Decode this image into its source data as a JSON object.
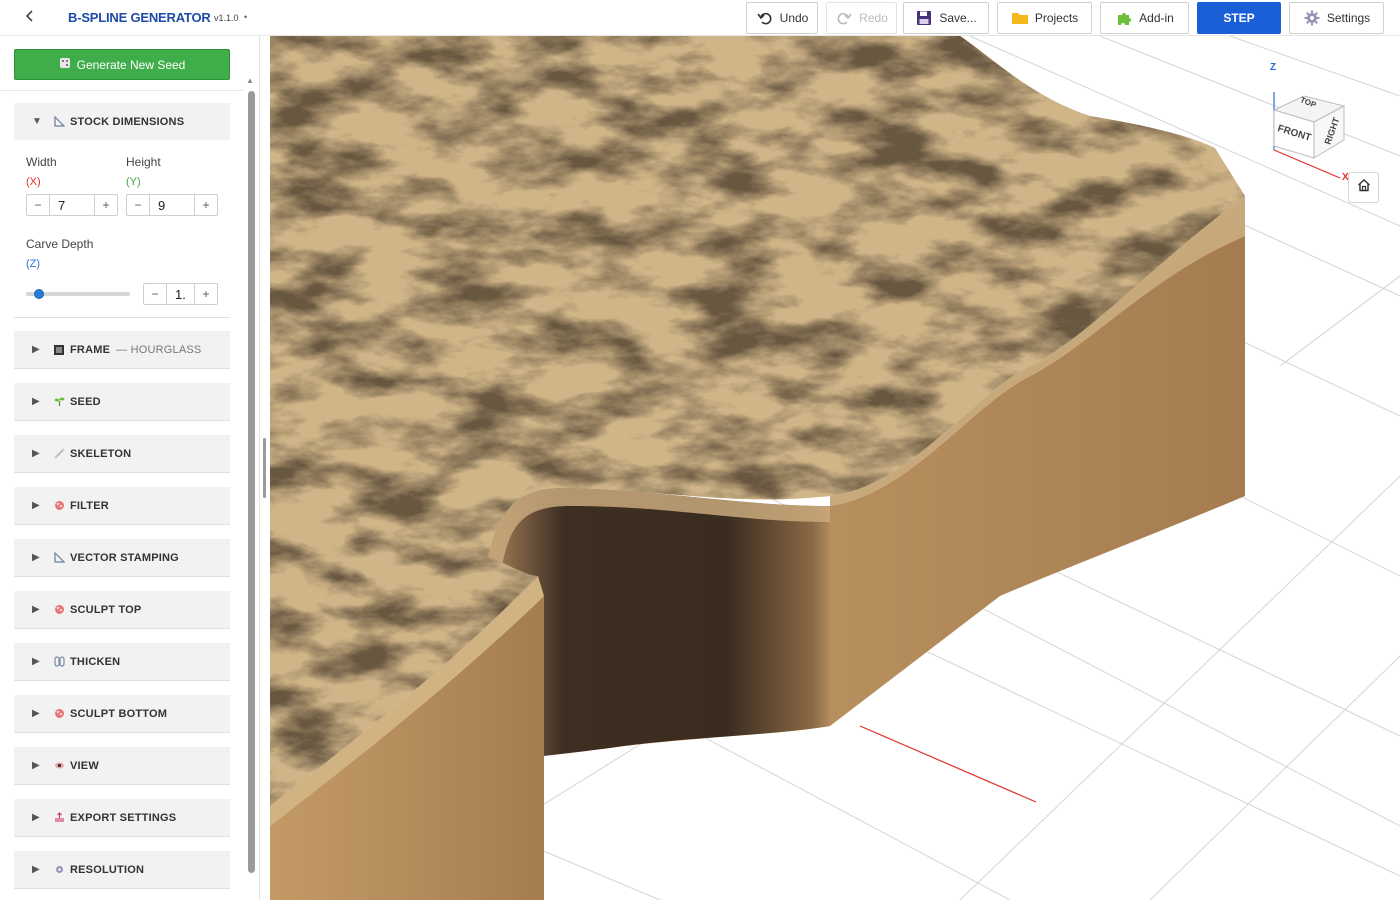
{
  "app": {
    "title": "B-SPLINE GENERATOR",
    "version": "v1.1.0",
    "dot": "•"
  },
  "toolbar": {
    "undo": "Undo",
    "redo": "Redo",
    "save": "Save...",
    "projects": "Projects",
    "addin": "Add-in",
    "step": "STEP",
    "settings": "Settings"
  },
  "sidebar": {
    "generate_label": "Generate New Seed",
    "stock": {
      "title": "STOCK DIMENSIONS",
      "width_label": "Width",
      "width_axis": "(X)",
      "width_value": "7",
      "height_label": "Height",
      "height_axis": "(Y)",
      "height_value": "9",
      "depth_label": "Carve Depth",
      "depth_axis": "(Z)",
      "depth_value": "1.",
      "depth_slider_fraction": 0.1
    },
    "sections": [
      {
        "title": "FRAME",
        "sub": "— HOURGLASS"
      },
      {
        "title": "SEED",
        "sub": ""
      },
      {
        "title": "SKELETON",
        "sub": ""
      },
      {
        "title": "FILTER",
        "sub": ""
      },
      {
        "title": "VECTOR STAMPING",
        "sub": ""
      },
      {
        "title": "SCULPT TOP",
        "sub": ""
      },
      {
        "title": "THICKEN",
        "sub": ""
      },
      {
        "title": "SCULPT BOTTOM",
        "sub": ""
      },
      {
        "title": "VIEW",
        "sub": ""
      },
      {
        "title": "EXPORT SETTINGS",
        "sub": ""
      },
      {
        "title": "RESOLUTION",
        "sub": ""
      }
    ]
  },
  "viewcube": {
    "top": "TOP",
    "front": "FRONT",
    "right": "RIGHT",
    "axis_z": "Z",
    "axis_x": "X"
  },
  "colors": {
    "accent": "#1a5ed8",
    "generate": "#3fae4a",
    "axis_x": "#e0302a",
    "axis_y": "#3aa845",
    "axis_z": "#2a6fd6"
  }
}
